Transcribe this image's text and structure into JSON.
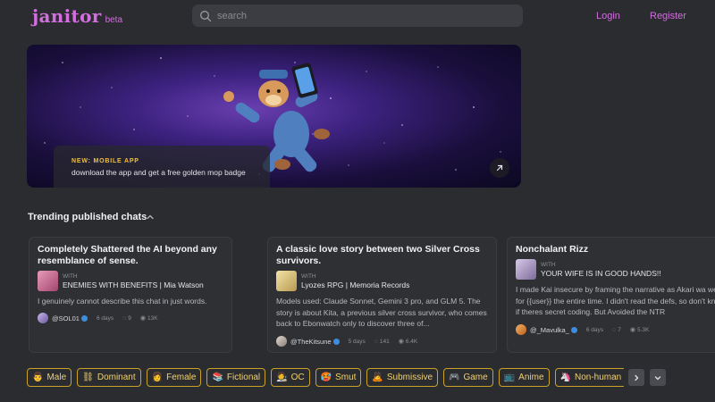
{
  "header": {
    "logo_text": "janitor",
    "logo_badge": "beta",
    "search_placeholder": "search",
    "login_label": "Login",
    "register_label": "Register"
  },
  "banner": {
    "tag": "NEW: MOBILE APP",
    "description": "download the app and get a free golden mop badge"
  },
  "trending": {
    "title": "Trending published chats",
    "cards": [
      {
        "title": "Completely Shattered the AI beyond any resemblance of sense.",
        "with_label": "WITH",
        "with_name": "ENEMIES WITH BENEFITS | Mia Watson",
        "description": "I genuinely cannot describe this chat in just words.",
        "author": "@SOL01",
        "age": "6 days",
        "comments": "9",
        "views": "13K"
      },
      {
        "title": "A classic love story between two Silver Cross survivors.",
        "with_label": "WITH",
        "with_name": "Lyozes RPG | Memoria Records",
        "description": "Models used: Claude Sonnet, Gemini 3 pro, and GLM 5. The story is about Kita, a previous silver cross survivor, who comes back to Ebonwatch only to discover three of...",
        "author": "@TheKitsune",
        "age": "5 days",
        "comments": "141",
        "views": "6.4K"
      },
      {
        "title": "Nonchalant Rizz",
        "with_label": "WITH",
        "with_name": "YOUR WIFE IS IN GOOD HANDS!!",
        "description": "I made Kai insecure by framing the narrative as Akari wa wet for {{user}} the entire time. I didn't read the defs, so don't know if theres secret coding. But Avoided the NTR",
        "author": "@_Mavulka_",
        "age": "6 days",
        "comments": "7",
        "views": "5.3K"
      }
    ]
  },
  "tags": [
    {
      "emoji": "👨",
      "label": "Male"
    },
    {
      "emoji": "⛓",
      "label": "Dominant"
    },
    {
      "emoji": "👩",
      "label": "Female"
    },
    {
      "emoji": "📚",
      "label": "Fictional"
    },
    {
      "emoji": "🧑‍🎨",
      "label": "OC"
    },
    {
      "emoji": "🥵",
      "label": "Smut"
    },
    {
      "emoji": "🙇",
      "label": "Submissive"
    },
    {
      "emoji": "🎮",
      "label": "Game"
    },
    {
      "emoji": "📺",
      "label": "Anime"
    },
    {
      "emoji": "🦄",
      "label": "Non-human"
    }
  ],
  "colors": {
    "accent": "#d46de0",
    "background": "#2b2c30",
    "tag_border": "#c9a227",
    "tag_text": "#f0d070"
  },
  "icons": [
    "search-icon",
    "arrow-up-right-icon",
    "chevron-up-icon",
    "chevron-right-icon",
    "chevron-down-icon",
    "comment-icon",
    "eye-icon"
  ]
}
